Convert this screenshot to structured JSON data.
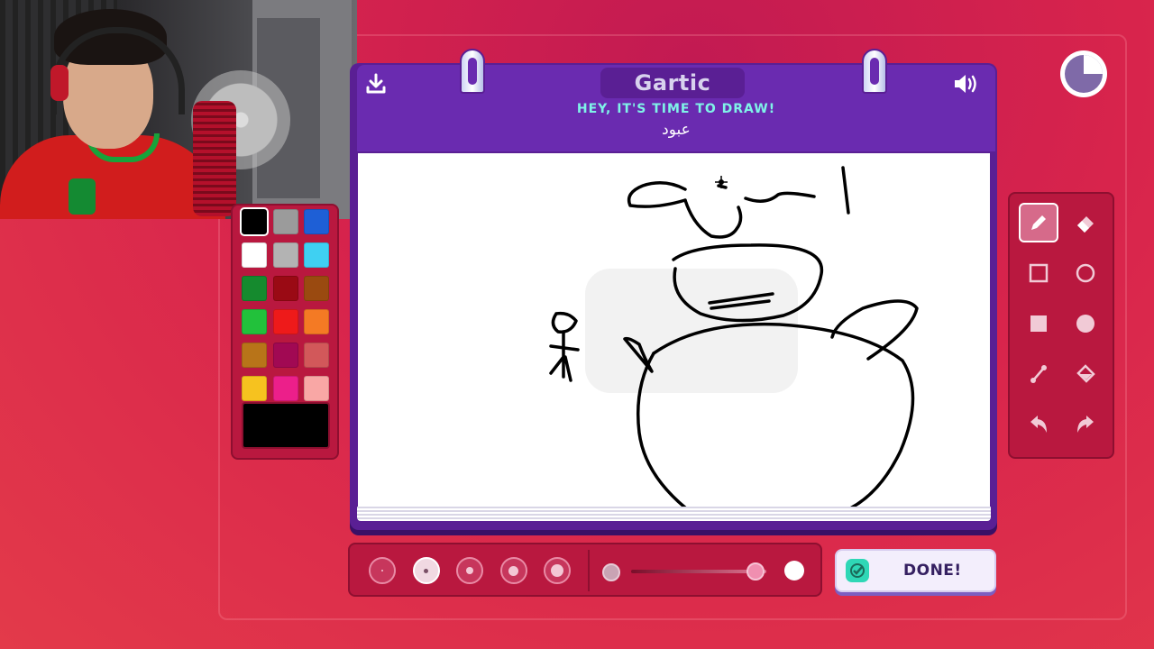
{
  "header": {
    "logo": "Gartic",
    "title": "HEY, IT'S TIME TO DRAW!",
    "word": "عبود"
  },
  "icons": {
    "download": "download-icon",
    "sound": "speaker-icon",
    "timer": "timer-icon"
  },
  "palette": {
    "colors": [
      "#000000",
      "#9b9b9b",
      "#1e5fd6",
      "#ffffff",
      "#b3b3b3",
      "#3fd0f2",
      "#158a2e",
      "#9a0a14",
      "#9a4a10",
      "#22c13b",
      "#ee1a1a",
      "#f47a24",
      "#b87419",
      "#a10953",
      "#d2585a",
      "#f6c21f",
      "#ec1f8a",
      "#f9a7a5"
    ],
    "selected_index": 0,
    "current_color": "#000000"
  },
  "tools": [
    "pencil-tool",
    "eraser-tool",
    "rectangle-outline-tool",
    "ellipse-outline-tool",
    "rectangle-fill-tool",
    "ellipse-fill-tool",
    "line-tool",
    "fill-bucket-tool",
    "undo-tool",
    "redo-tool"
  ],
  "active_tool": "pencil-tool",
  "brush_sizes": {
    "count": 5,
    "selected_index": 1
  },
  "opacity": {
    "value": 0.92
  },
  "done_button": {
    "label": "DONE!"
  },
  "colors": {
    "background": "#d8244c",
    "board": "#6a2bb0",
    "accent_text": "#7ff3e8"
  }
}
